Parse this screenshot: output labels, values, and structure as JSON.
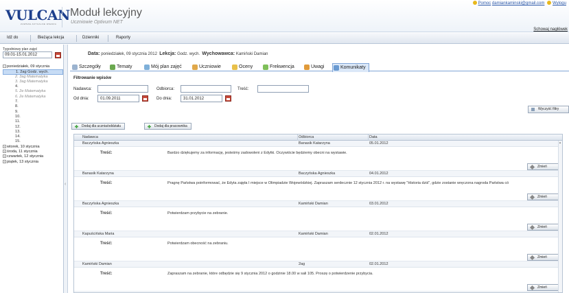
{
  "header": {
    "logo": "VULCAN",
    "logo_sub": "ZAWSZE AKTUALNE WIEDZA",
    "title": "Moduł lekcyjny",
    "subtitle": "Uczniowie Optivum NET",
    "help_link": "Pomoc",
    "user_email": "damiankaminski@gmail.com",
    "logout_link": "Wylogu",
    "hide_panel": "Schowaj nagłówek"
  },
  "menu": [
    "Idź do",
    "Bieżąca lekcja",
    "Dzienniki",
    "Raporty"
  ],
  "left": {
    "week_label": "Tygodniowy plan zajęć",
    "week_value": "09.01-15.01.2012",
    "days": [
      {
        "label": "poniedziałek, 09 stycznia",
        "expanded": true
      },
      {
        "label": "wtorek, 10 stycznia",
        "expanded": false
      },
      {
        "label": "środa, 11 stycznia",
        "expanded": false
      },
      {
        "label": "czwartek, 12 stycznia",
        "expanded": false
      },
      {
        "label": "piątek, 13 stycznia",
        "expanded": false
      }
    ],
    "lessons": [
      "1. 2ag Godz. wych.",
      "2. 3ag Matematyka",
      "3. 3ag Matematyka",
      "4.",
      "5. 2e Matematyka",
      "6. 2e Matematyka",
      "7.",
      "8.",
      "9.",
      "10.",
      "11.",
      "12.",
      "13.",
      "14.",
      "15."
    ]
  },
  "info": {
    "date_label": "Data:",
    "date_value": "poniedziałek, 09 stycznia 2012",
    "lesson_label": "Lekcja:",
    "lesson_value": "Godz. wych.",
    "teacher_label": "Wychowawca:",
    "teacher_value": "Kamiński Damian"
  },
  "tabs": [
    "Szczegóły",
    "Tematy",
    "Mój plan zajęć",
    "Uczniowie",
    "Oceny",
    "Frekwencja",
    "Uwagi",
    "Komunikaty"
  ],
  "filter": {
    "title": "Filtrowanie wpisów",
    "sender_label": "Nadawca:",
    "sender_value": "",
    "recipient_label": "Odbiorca:",
    "recipient_value": "",
    "content_label": "Treść:",
    "content_value": "",
    "from_label": "Od dnia:",
    "from_value": "01.09.2011",
    "to_label": "Do dnia:",
    "to_value": "31.01.2012",
    "clear_button": "Wyczyść filtry"
  },
  "actions": {
    "add_student": "Dodaj dla ucznia/oddziału",
    "add_staff": "Dodaj dla pracownika"
  },
  "grid": {
    "columns": [
      "Nadawca",
      "Odbiorca",
      "Data"
    ],
    "content_label": "Treść:",
    "change_button": "Zmień",
    "rows": [
      {
        "sender": "Baczyńska Agnieszka",
        "recipient": "Banasik Katarzyna",
        "date": "05.01.2012",
        "content": "Bardzo dziękujemy za informację, jesteśmy zadowoleni z Edytki. Oczywiście będziemy obecni na wystawie."
      },
      {
        "sender": "Banasik Katarzyna",
        "recipient": "Baczyńska Agnieszka",
        "date": "04.01.2012",
        "content": "Pragnę Państwa poinformować, że Edyta zajęła I miejsce w Olimpiadzie Wojewódzkiej. Zapraszam serdecznie 12 stycznia 2012 r. na wystawę \"Historia dziś\", gdzie zostanie wręczona nagroda Państwa có"
      },
      {
        "sender": "Baczyńska Agnieszka",
        "recipient": "Kamiński Damian",
        "date": "03.01.2012",
        "content": "Potwierdzam przybycie na zebranie."
      },
      {
        "sender": "Kapuścińska Maria",
        "recipient": "Kamiński Damian",
        "date": "02.01.2012",
        "content": "Potwierdzam obecność na zebraniu."
      },
      {
        "sender": "Kamiński Damian",
        "recipient": "2ag",
        "date": "02.01.2012",
        "content": "Zapraszam na zebranie, które odbędzie się 9 stycznia 2012 o godzinie 18.00 w sali 105. Proszę o potwierdzenie przybycia."
      }
    ]
  },
  "colors": {
    "brand": "#1d3f8c",
    "accent": "#c2161b",
    "tab_active": "#dbe8f8",
    "selected": "#c7dcf5"
  }
}
